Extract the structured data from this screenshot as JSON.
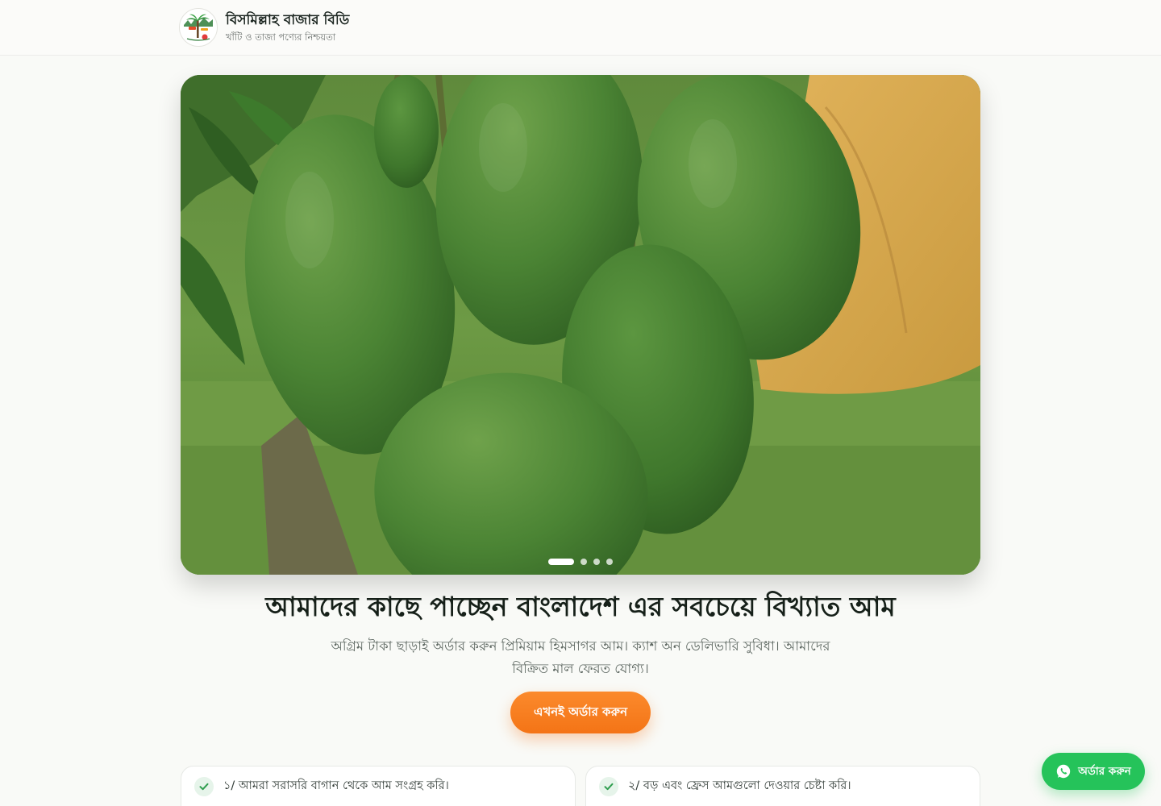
{
  "brand": {
    "name": "বিসমিল্লাহ বাজার বিডি",
    "tagline": "খাঁটি ও তাজা পণ্যের নিশ্চয়তা"
  },
  "hero": {
    "slide_count": 4,
    "active_slide": 1
  },
  "headline": "আমাদের কাছে পাচ্ছেন বাংলাদেশ এর সবচেয়ে বিখ্যাত আম",
  "subtext": "অগ্রিম টাকা ছাড়াই অর্ডার করুন প্রিমিয়াম হিমসাগর আম। ক্যাশ অন ডেলিভারি সুবিধা। আমাদের বিক্রিত মাল ফেরত যোগ্য।",
  "cta_label": "এখনই অর্ডার করুন",
  "features": [
    {
      "text": "১/ আমরা সরাসরি বাগান থেকে আম সংগ্রহ করি।"
    },
    {
      "text": "২/ বড় এবং ফ্রেস আমগুলো দেওয়ার চেষ্টা করি।"
    }
  ],
  "whatsapp": {
    "label": "অর্ডার করুন",
    "icon": "whatsapp-icon",
    "color": "#25c35a"
  },
  "colors": {
    "accent": "#f47416",
    "whatsapp": "#25c35a",
    "check": "#2f9e4f"
  }
}
